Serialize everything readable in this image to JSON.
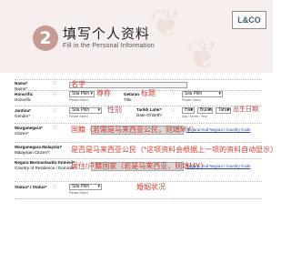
{
  "header": {
    "step": "2",
    "title": "填写个人资料",
    "subtitle": "Fill in the Personal Information",
    "logo": "L&CO"
  },
  "rows": {
    "name": {
      "label": "Nama*",
      "sub": "Name*",
      "note": "名字"
    },
    "title": {
      "label": "Honorific",
      "sub": "Honorific",
      "select": "Sila Pilih",
      "hint": "Please Select",
      "note_1": "尊称",
      "gelaran_label": "Gelaran",
      "gelaran_sub": "Title",
      "note_2": "标题",
      "select_2": "Sila Pilih",
      "hint_2": "Please Select"
    },
    "gender": {
      "label": "Jantina*",
      "sub": "Gender*",
      "select": "Sila Pilih",
      "hint": "Please Select",
      "note": "性别",
      "dob_label": "Tarikh Lahir*",
      "dob_sub": "Date Of Birth*",
      "day": "Hari",
      "month": "Bulan",
      "year": "Tahun",
      "dob_hint": "Day / Month / Year",
      "dob_note": "出生日期"
    },
    "citizen": {
      "label": "Warganegara*",
      "sub": "Citizen*",
      "note": "国籍（若需是马来西亚公民，则填MY）",
      "link": "Senarai Kod Negara / Country Code"
    },
    "pr": {
      "label": "Warganegara Malaysia?",
      "sub": "Malaysian Citizen?",
      "note": "是否是马来西亚公民（*这项资料会根据上一项的资料自动显示）"
    },
    "residence": {
      "label": "Negara Bermastautin Domisil*",
      "sub": "Country of Residence / Domicile*",
      "note": "居住/户籍国家（若是马来西亚，则填MY）",
      "link": "Senarai Kod Negara / Country Code"
    },
    "status": {
      "label": "Status* / Status*",
      "select": "Sila Pilih",
      "hint": "Please Select",
      "note": "婚姻状况"
    }
  },
  "colors": {
    "accent": "#c79a93",
    "note": "#d24236",
    "header_bg": "#f6efed"
  }
}
